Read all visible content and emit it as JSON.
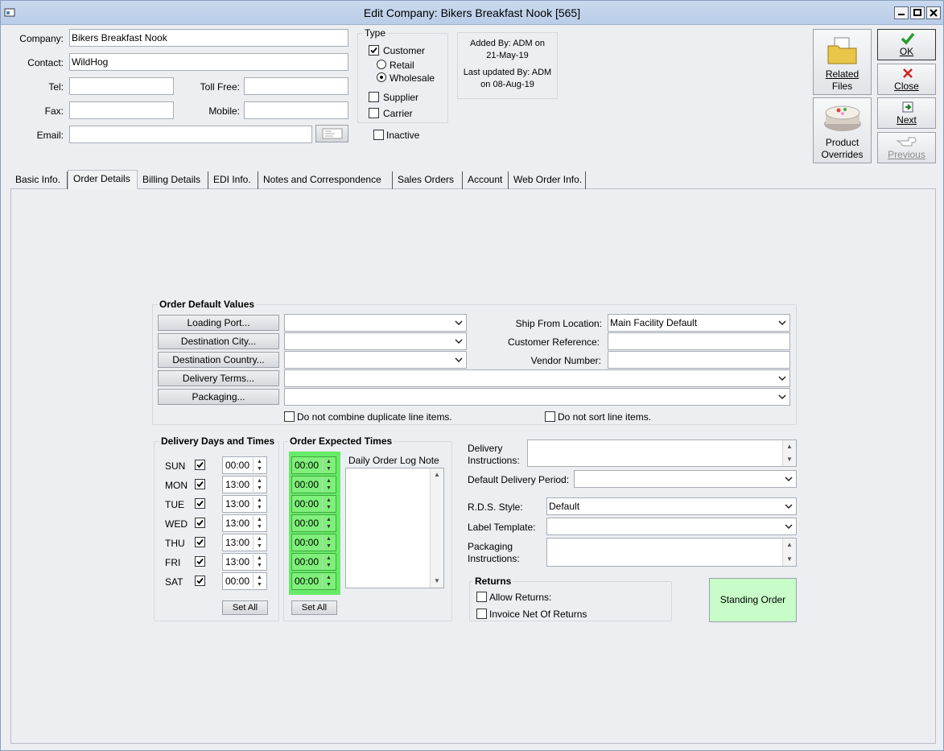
{
  "window": {
    "title": "Edit Company: Bikers Breakfast Nook [565]"
  },
  "header": {
    "company_label": "Company:",
    "company_value": "Bikers Breakfast Nook",
    "contact_label": "Contact:",
    "contact_value": "WildHog",
    "tel_label": "Tel:",
    "tel_value": "",
    "tollfree_label": "Toll Free:",
    "tollfree_value": "",
    "fax_label": "Fax:",
    "fax_value": "",
    "mobile_label": "Mobile:",
    "mobile_value": "",
    "email_label": "Email:",
    "email_value": ""
  },
  "type_group": {
    "title": "Type",
    "customer_label": "Customer",
    "customer_checked": true,
    "retail_label": "Retail",
    "wholesale_label": "Wholesale",
    "wholesale_selected": true,
    "supplier_label": "Supplier",
    "carrier_label": "Carrier",
    "inactive_label": "Inactive"
  },
  "audit": {
    "added_line1": "Added By: ADM on",
    "added_line2": "21-May-19",
    "updated_line1": "Last updated By: ADM",
    "updated_line2": "on 08-Aug-19"
  },
  "actions": {
    "ok": "OK",
    "close": "Close",
    "next": "Next",
    "previous": "Previous",
    "related_files_1": "Related",
    "related_files_2": "Files",
    "product_overrides_1": "Product",
    "product_overrides_2": "Overrides"
  },
  "tabs": [
    "Basic Info.",
    "Order Details",
    "Billing Details",
    "EDI Info.",
    "Notes and Correspondence",
    "Sales Orders",
    "Account",
    "Web Order Info."
  ],
  "order_defaults": {
    "title": "Order Default Values",
    "loading_port": "Loading Port...",
    "destination_city": "Destination City...",
    "destination_country": "Destination Country...",
    "delivery_terms": "Delivery Terms...",
    "packaging": "Packaging...",
    "ship_from_label": "Ship From Location:",
    "ship_from_value": "Main Facility Default",
    "customer_ref_label": "Customer Reference:",
    "vendor_number_label": "Vendor Number:",
    "no_combine_label": "Do not combine duplicate line items.",
    "no_sort_label": "Do not sort line items."
  },
  "delivery_days": {
    "title": "Delivery Days and Times",
    "days": [
      {
        "day": "SUN",
        "time": "00:00"
      },
      {
        "day": "MON",
        "time": "13:00"
      },
      {
        "day": "TUE",
        "time": "13:00"
      },
      {
        "day": "WED",
        "time": "13:00"
      },
      {
        "day": "THU",
        "time": "13:00"
      },
      {
        "day": "FRI",
        "time": "13:00"
      },
      {
        "day": "SAT",
        "time": "00:00"
      }
    ],
    "set_all": "Set All"
  },
  "expected_times": {
    "title": "Order Expected Times",
    "times": [
      "00:00",
      "00:00",
      "00:00",
      "00:00",
      "00:00",
      "00:00",
      "00:00"
    ],
    "set_all": "Set All",
    "log_note_label": "Daily Order Log Note"
  },
  "delivery": {
    "instructions_label_1": "Delivery",
    "instructions_label_2": "Instructions:",
    "default_period_label": "Default Delivery Period:",
    "rds_style_label": "R.D.S. Style:",
    "rds_style_value": "Default",
    "label_template_label": "Label Template:",
    "packaging_instr_label_1": "Packaging",
    "packaging_instr_label_2": "Instructions:"
  },
  "returns": {
    "title": "Returns",
    "allow_label": "Allow Returns:",
    "net_label": "Invoice Net Of Returns"
  },
  "standing_order": "Standing Order",
  "colors": {
    "green_highlight": "#66ec66",
    "standing_order_bg": "#c8fcc8"
  }
}
